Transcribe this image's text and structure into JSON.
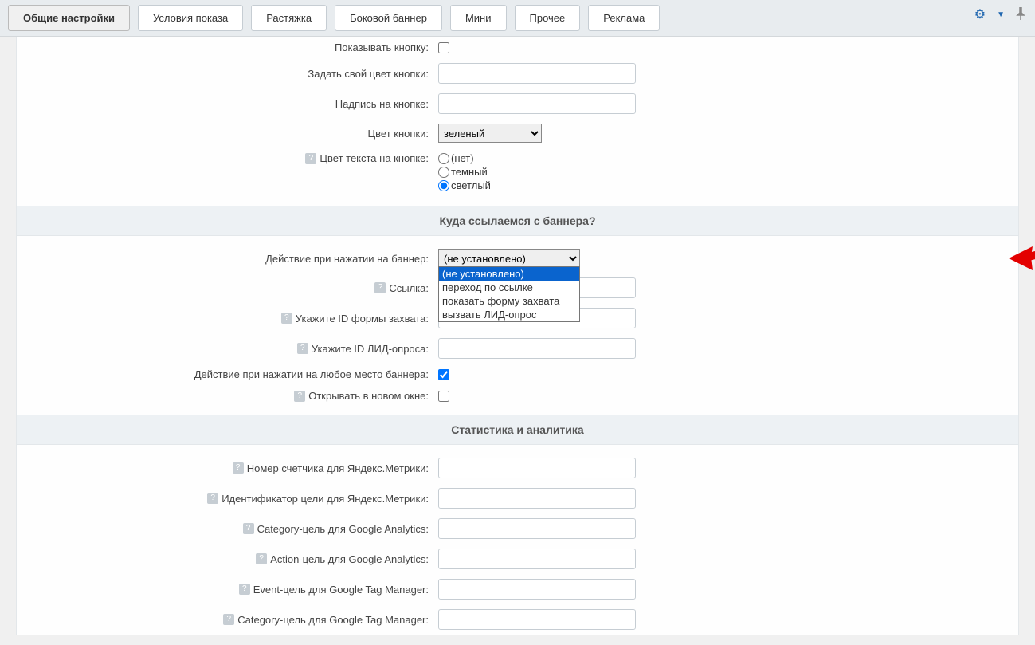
{
  "tabs": {
    "t0": "Общие настройки",
    "t1": "Условия показа",
    "t2": "Растяжка",
    "t3": "Боковой баннер",
    "t4": "Мини",
    "t5": "Прочее",
    "t6": "Реклама"
  },
  "labels": {
    "show_button": "Показывать кнопку:",
    "custom_color": "Задать свой цвет кнопки:",
    "button_text": "Надпись на кнопке:",
    "button_color": "Цвет кнопки:",
    "text_color": "Цвет текста на кнопке:",
    "link_section": "Куда ссылаемся с баннера?",
    "click_action": "Действие при нажатии на баннер:",
    "link": "Ссылка:",
    "form_id": "Укажите ID формы захвата:",
    "lead_id": "Укажите ID ЛИД-опроса:",
    "full_click": "Действие при нажатии на любое место баннера:",
    "new_window": "Открывать в новом окне:",
    "stats_section": "Статистика и аналитика",
    "ym_counter": "Номер счетчика для Яндекс.Метрики:",
    "ym_goal": "Идентификатор цели для Яндекс.Метрики:",
    "ga_category": "Category-цель для Google Analytics:",
    "ga_action": "Action-цель для Google Analytics:",
    "gtm_event": "Event-цель для Google Tag Manager:",
    "gtm_category": "Category-цель для Google Tag Manager:"
  },
  "values": {
    "button_color_selected": "зеленый",
    "radio_none": "(нет)",
    "radio_dark": "темный",
    "radio_light": "светлый",
    "click_action_selected": "(не установлено)"
  },
  "dropdown": {
    "opt0": "(не установлено)",
    "opt1": "переход по ссылке",
    "opt2": "показать форму захвата",
    "opt3": "вызвать ЛИД-опрос"
  }
}
